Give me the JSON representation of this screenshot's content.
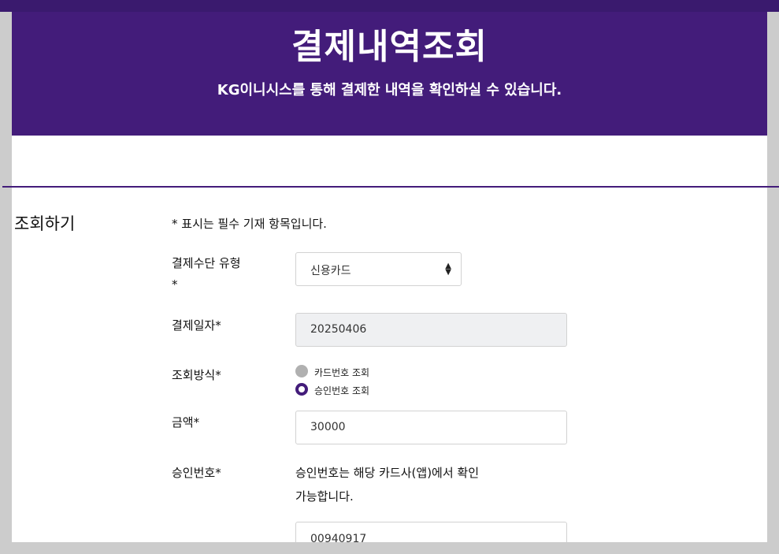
{
  "header": {
    "title": "결제내역조회",
    "subtitle": "KG이니시스를 통해 결제한 내역을 확인하실 수 있습니다."
  },
  "section": {
    "title": "조회하기",
    "required_note": "* 표시는 필수 기재 항목입니다."
  },
  "form": {
    "payment_type": {
      "label": "결제수단 유형",
      "required_mark": "*",
      "value": "신용카드"
    },
    "payment_date": {
      "label": "결제일자*",
      "value": "20250406"
    },
    "lookup_method": {
      "label": "조회방식*",
      "options": [
        {
          "label": "카드번호 조회",
          "selected": false
        },
        {
          "label": "승인번호 조회",
          "selected": true
        }
      ]
    },
    "amount": {
      "label": "금액*",
      "value": "30000"
    },
    "approval_number": {
      "label": "승인번호*",
      "help_line1": "승인번호는 해당 카드사(앱)에서 확인",
      "help_line2": "가능합니다.",
      "value": "00940917"
    }
  },
  "colors": {
    "brand": "#431c7a",
    "page_bg": "#cccccc"
  },
  "icons": {
    "select_arrow": "sort-arrows-icon"
  }
}
